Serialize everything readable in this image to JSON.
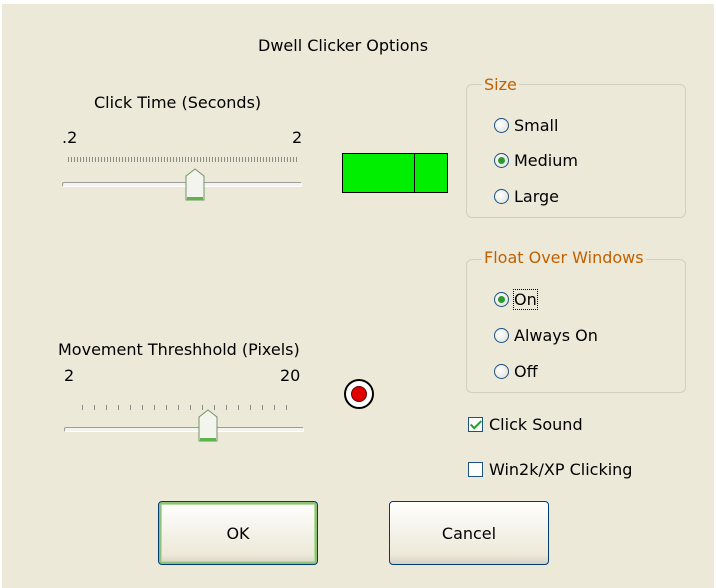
{
  "dialog": {
    "title": "Dwell Clicker Options"
  },
  "click_time": {
    "label": "Click Time (Seconds)",
    "min_label": ".2",
    "max_label": "2",
    "value_fraction": 0.5
  },
  "movement": {
    "label": "Movement Threshhold (Pixels)",
    "min_label": "2",
    "max_label": "20",
    "value_fraction": 0.6
  },
  "size_group": {
    "legend": "Size",
    "options": [
      "Small",
      "Medium",
      "Large"
    ],
    "selected": "Medium"
  },
  "float_group": {
    "legend": "Float Over Windows",
    "options": [
      "On",
      "Always On",
      "Off"
    ],
    "selected": "On"
  },
  "checks": {
    "click_sound": {
      "label": "Click Sound",
      "checked": true
    },
    "win2k_clicking": {
      "label": "Win2k/XP Clicking",
      "checked": false
    }
  },
  "buttons": {
    "ok": "OK",
    "cancel": "Cancel"
  },
  "colors": {
    "face": "#ece9d8",
    "preview_green": "#00ee00",
    "target_red": "#e00000",
    "group_legend": "#c06000"
  }
}
